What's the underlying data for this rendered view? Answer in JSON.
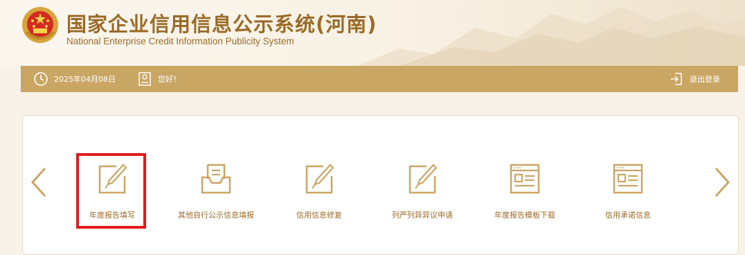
{
  "header": {
    "title_cn": "国家企业信用信息公示系统(河南)",
    "title_en": "National Enterprise Credit Information Publicity System"
  },
  "topbar": {
    "date": "2025年04月08日",
    "greeting": "您好！",
    "logout": "退出登录",
    "icons": [
      "clock-icon",
      "user-badge-icon",
      "logout-icon"
    ]
  },
  "carousel": {
    "items": [
      {
        "label": "年度报告填写",
        "icon": "edit-icon",
        "selected": true
      },
      {
        "label": "其他自行公示信息填报",
        "icon": "inbox-document-icon",
        "selected": false
      },
      {
        "label": "信用信息修复",
        "icon": "edit-icon",
        "selected": false
      },
      {
        "label": "列严列异异议申请",
        "icon": "edit-icon",
        "selected": false
      },
      {
        "label": "年度报告模板下载",
        "icon": "template-window-icon",
        "selected": false
      },
      {
        "label": "信用承诺信息",
        "icon": "template-window-icon",
        "selected": false
      }
    ],
    "prev_icon": "chevron-left-icon",
    "next_icon": "chevron-right-icon"
  },
  "colors": {
    "gold": "#c9a664",
    "brown_text": "#9a6b27",
    "highlight_red": "#e21b1b",
    "background": "#f8f2e8"
  }
}
